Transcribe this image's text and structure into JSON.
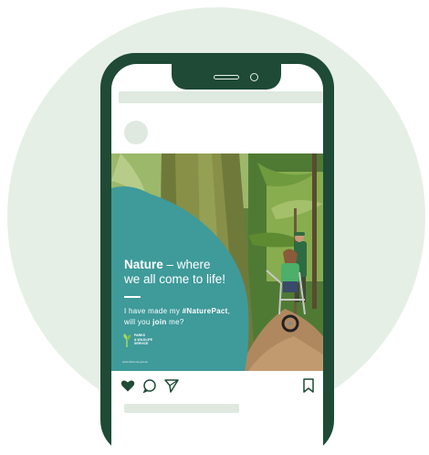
{
  "post": {
    "headline_bold": "Nature",
    "headline_rest": " – where",
    "headline_line2": "we all come to life!",
    "pact_line1_prefix": "I have made my ",
    "pact_hashtag": "#NaturePact",
    "pact_line1_suffix": ",",
    "pact_line2_prefix": "will you ",
    "pact_join": "join",
    "pact_line2_suffix": " me?"
  },
  "brand": {
    "line1": "PARKS",
    "line2": "& WILDLIFE",
    "line3": "SERVICE"
  },
  "caption_small": "www.dbca.wa.gov.au",
  "icons": {
    "like": "heart-icon",
    "comment": "comment-icon",
    "share": "send-icon",
    "save": "bookmark-icon"
  },
  "colors": {
    "phone": "#1e4a36",
    "teal_overlay": "#3f9a9a",
    "background_circle": "#e6efe6",
    "placeholder": "#dfe9df"
  }
}
